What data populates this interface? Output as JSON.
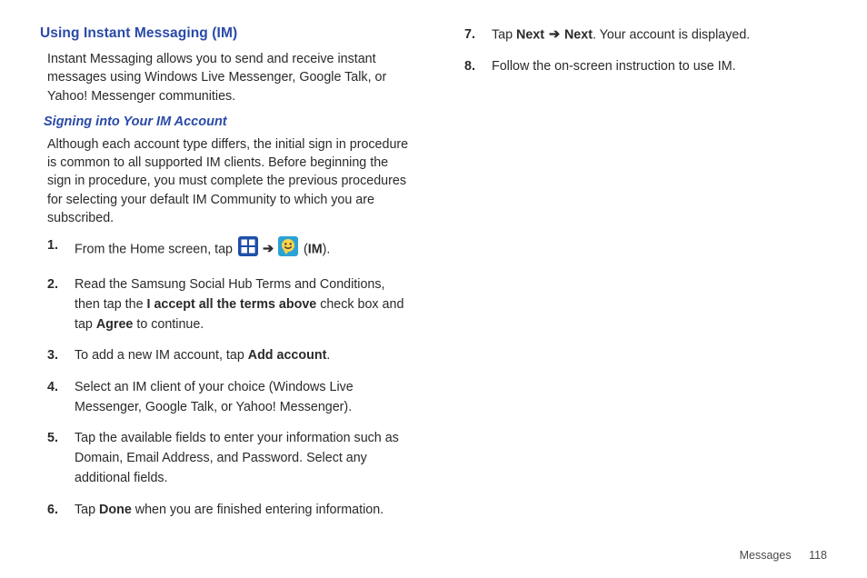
{
  "heading": "Using Instant Messaging (IM)",
  "intro": "Instant Messaging allows you to send and receive instant messages using Windows Live Messenger, Google Talk, or Yahoo! Messenger communities.",
  "subheading": "Signing into Your IM Account",
  "subintro": "Although each account type differs, the initial sign in procedure is common to all supported IM clients. Before beginning the sign in procedure, you must complete the previous procedures for selecting your default IM Community to which you are subscribed.",
  "steps": {
    "s1a": "From the Home screen, tap ",
    "s1b": " (",
    "s1c": "IM",
    "s1d": ").",
    "arrow": "➔",
    "s2a": "Read the Samsung Social Hub Terms and Conditions, then tap the ",
    "s2b": "I accept all the terms above",
    "s2c": " check box and tap ",
    "s2d": "Agree",
    "s2e": " to continue.",
    "s3a": "To add a new IM account, tap ",
    "s3b": "Add account",
    "s3c": ".",
    "s4": "Select an IM client of your choice (Windows Live Messenger, Google Talk, or Yahoo! Messenger).",
    "s5": "Tap the available fields to enter your information such as Domain, Email Address, and Password. Select any additional fields.",
    "s6a": "Tap ",
    "s6b": "Done",
    "s6c": " when you are finished entering information.",
    "s7a": "Tap ",
    "s7b": "Next",
    "s7c": "Next",
    "s7d": ". Your account is displayed.",
    "s8": "Follow the on-screen instruction to use IM."
  },
  "footer": {
    "section": "Messages",
    "page": "118"
  }
}
